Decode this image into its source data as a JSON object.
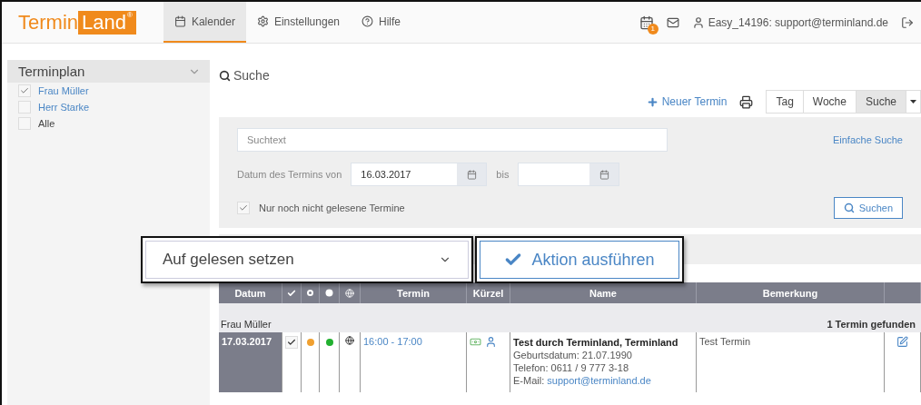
{
  "nav": {
    "logo": {
      "first": "Termin",
      "second": "Land",
      "mark": "®"
    },
    "tabs": [
      {
        "label": "Kalender",
        "selected": true
      },
      {
        "label": "Einstellungen",
        "selected": false
      },
      {
        "label": "Hilfe",
        "selected": false
      }
    ],
    "badge": "1",
    "user": "Easy_14196: support@terminland.de"
  },
  "sidebar": {
    "title": "Terminplan",
    "items": [
      {
        "label": "Frau Müller",
        "checked": true,
        "kind": "link"
      },
      {
        "label": "Herr Starke",
        "checked": false,
        "kind": "link"
      },
      {
        "label": "Alle",
        "checked": false,
        "kind": "plain"
      }
    ]
  },
  "main": {
    "heading": "Suche",
    "new_button": "Neuer Termin",
    "views": [
      {
        "label": "Tag",
        "selected": false
      },
      {
        "label": "Woche",
        "selected": false
      },
      {
        "label": "Suche",
        "selected": true
      }
    ],
    "search": {
      "placeholder": "Suchtext",
      "simple_link": "Einfache Suche",
      "date_label": "Datum des Termins von",
      "date_from": "16.03.2017",
      "until_label": "bis",
      "unread_only": {
        "label": "Nur noch nicht gelesene Termine",
        "checked": true
      },
      "button": "Suchen"
    },
    "action": {
      "select": "Auf gelesen setzen",
      "button": "Aktion ausführen"
    },
    "table": {
      "columns": [
        {
          "kind": "text",
          "label": "Datum"
        },
        {
          "kind": "check"
        },
        {
          "kind": "ring"
        },
        {
          "kind": "dot"
        },
        {
          "kind": "globe"
        },
        {
          "kind": "text",
          "label": "Termin"
        },
        {
          "kind": "text",
          "label": "Kürzel"
        },
        {
          "kind": "text",
          "label": "Name"
        },
        {
          "kind": "text",
          "label": "Bemerkung"
        },
        {
          "kind": "blank"
        }
      ],
      "group": "Frau Müller",
      "count": "1 Termin gefunden",
      "rows": [
        {
          "date": "17.03.2017",
          "read": true,
          "indicators": [
            {
              "color": "#f0a030"
            },
            {
              "color": "#22b030"
            }
          ],
          "time": "16:00 - 17:00",
          "name": "Test durch Terminland, Terminland",
          "details": [
            "Geburtsdatum: 21.07.1990",
            "Telefon: 0611 / 9 777 3-18"
          ],
          "email_label": "E-Mail:",
          "email": "support@terminland.de",
          "remark": "Test Termin"
        }
      ]
    }
  }
}
